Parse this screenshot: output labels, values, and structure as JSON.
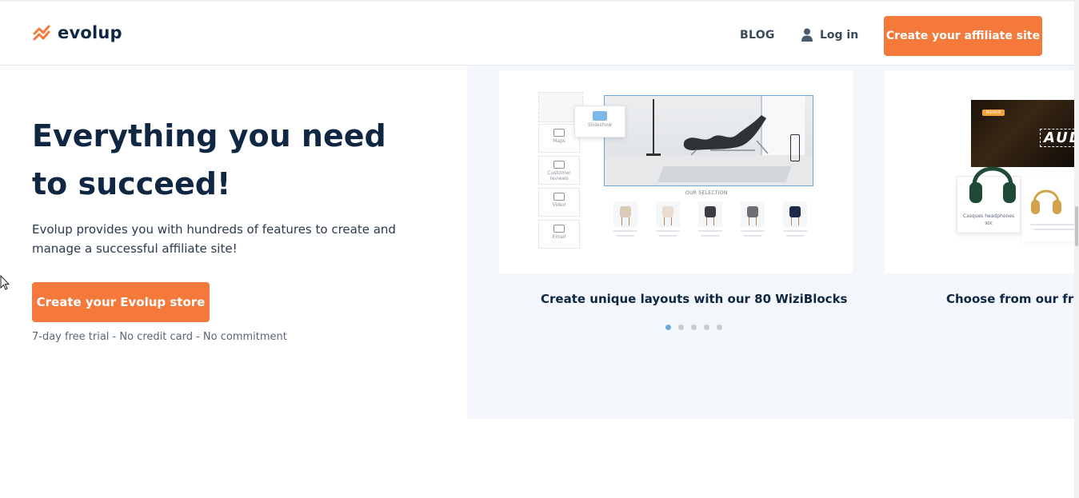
{
  "header": {
    "logo_text": "evolup",
    "nav": {
      "blog_label": "BLOG",
      "login_label": "Log in"
    },
    "cta_label": "Create your affiliate site"
  },
  "hero": {
    "title": "Everything you need to succeed!",
    "description": "Evolup provides you with hundreds of features to create and manage a successful affiliate site!",
    "cta_label": "Create your Evolup store",
    "trial_note": "7-day free trial - No credit card - No commitment"
  },
  "carousel": {
    "slides": [
      {
        "caption": "Create unique layouts with our 80 WiziBlocks",
        "mockup": {
          "side_blocks": [
            "Maps",
            "Customer reviews",
            "Video",
            "Email"
          ],
          "floating_block": "Slideshow",
          "selection_label": "OUR SELECTION",
          "product_colors": [
            "#d9cbb8",
            "#e8ddd0",
            "#3b3d40",
            "#6e7074",
            "#1d2a4a"
          ]
        }
      },
      {
        "caption": "Choose from our free",
        "mockup": {
          "badge": "PREMIUM",
          "banner_text": "AUD",
          "product_label": "Casques headphones",
          "product_price": "90€"
        }
      }
    ],
    "dots": [
      {
        "active": true
      },
      {
        "active": false
      },
      {
        "active": false
      },
      {
        "active": false
      },
      {
        "active": false
      }
    ]
  },
  "colors": {
    "accent": "#f4793a",
    "heading": "#0f2742",
    "carousel_bg": "#f3f6fa",
    "dot_active": "#6aa8e0"
  }
}
